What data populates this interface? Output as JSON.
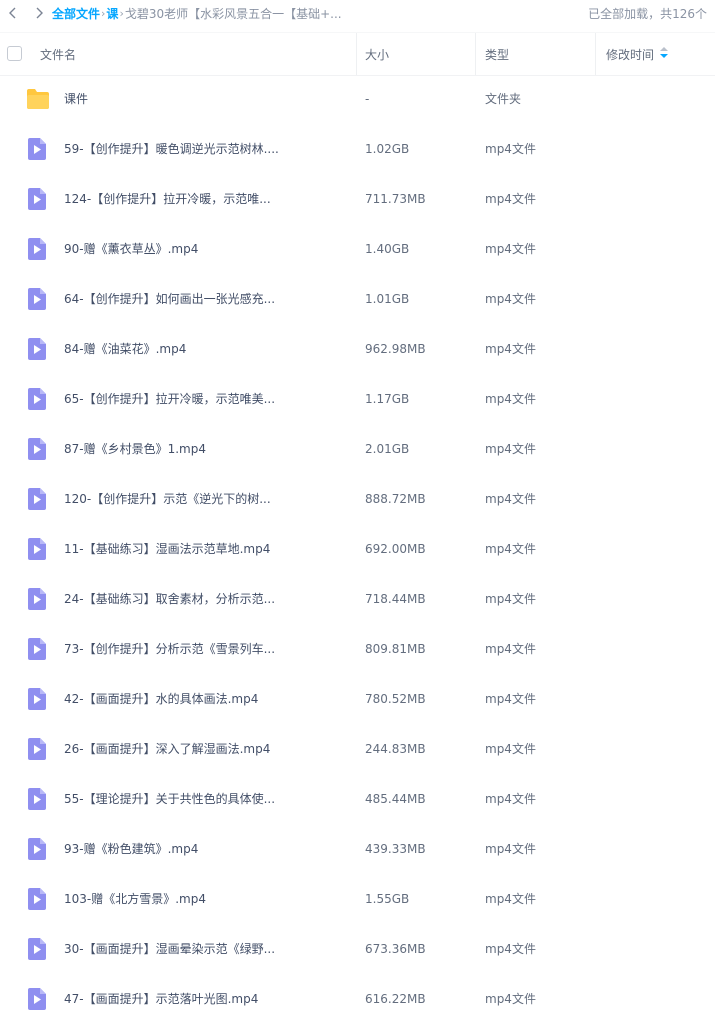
{
  "nav": {
    "crumbs": [
      "全部文件",
      "课",
      "戈碧30老师【水彩风景五合一【基础+..."
    ],
    "status": "已全部加载，共126个"
  },
  "table": {
    "columns": {
      "name": "文件名",
      "size": "大小",
      "type": "类型",
      "modified": "修改时间"
    },
    "rows": [
      {
        "icon": "folder-icon",
        "name": "课件",
        "size": "-",
        "type": "文件夹"
      },
      {
        "icon": "video-file-icon",
        "name": "59-【创作提升】暖色调逆光示范树林....",
        "size": "1.02GB",
        "type": "mp4文件"
      },
      {
        "icon": "video-file-icon",
        "name": "124-【创作提升】拉开冷暖，示范唯...",
        "size": "711.73MB",
        "type": "mp4文件"
      },
      {
        "icon": "video-file-icon",
        "name": "90-赠《薰衣草丛》.mp4",
        "size": "1.40GB",
        "type": "mp4文件"
      },
      {
        "icon": "video-file-icon",
        "name": "64-【创作提升】如何画出一张光感充...",
        "size": "1.01GB",
        "type": "mp4文件"
      },
      {
        "icon": "video-file-icon",
        "name": "84-赠《油菜花》.mp4",
        "size": "962.98MB",
        "type": "mp4文件"
      },
      {
        "icon": "video-file-icon",
        "name": "65-【创作提升】拉开冷暖，示范唯美...",
        "size": "1.17GB",
        "type": "mp4文件"
      },
      {
        "icon": "video-file-icon",
        "name": "87-赠《乡村景色》1.mp4",
        "size": "2.01GB",
        "type": "mp4文件"
      },
      {
        "icon": "video-file-icon",
        "name": "120-【创作提升】示范《逆光下的树...",
        "size": "888.72MB",
        "type": "mp4文件"
      },
      {
        "icon": "video-file-icon",
        "name": "11-【基础练习】湿画法示范草地.mp4",
        "size": "692.00MB",
        "type": "mp4文件"
      },
      {
        "icon": "video-file-icon",
        "name": "24-【基础练习】取舍素材，分析示范...",
        "size": "718.44MB",
        "type": "mp4文件"
      },
      {
        "icon": "video-file-icon",
        "name": "73-【创作提升】分析示范《雪景列车...",
        "size": "809.81MB",
        "type": "mp4文件"
      },
      {
        "icon": "video-file-icon",
        "name": "42-【画面提升】水的具体画法.mp4",
        "size": "780.52MB",
        "type": "mp4文件"
      },
      {
        "icon": "video-file-icon",
        "name": "26-【画面提升】深入了解湿画法.mp4",
        "size": "244.83MB",
        "type": "mp4文件"
      },
      {
        "icon": "video-file-icon",
        "name": "55-【理论提升】关于共性色的具体使...",
        "size": "485.44MB",
        "type": "mp4文件"
      },
      {
        "icon": "video-file-icon",
        "name": "93-赠《粉色建筑》.mp4",
        "size": "439.33MB",
        "type": "mp4文件"
      },
      {
        "icon": "video-file-icon",
        "name": "103-赠《北方雪景》.mp4",
        "size": "1.55GB",
        "type": "mp4文件"
      },
      {
        "icon": "video-file-icon",
        "name": "30-【画面提升】湿画晕染示范《绿野...",
        "size": "673.36MB",
        "type": "mp4文件"
      },
      {
        "icon": "video-file-icon",
        "name": "47-【画面提升】示范落叶光图.mp4",
        "size": "616.22MB",
        "type": "mp4文件"
      }
    ]
  },
  "colors": {
    "accent": "#06a7ff",
    "video_icon": "#8f8ff0",
    "folder_icon": "#ffc73f"
  }
}
